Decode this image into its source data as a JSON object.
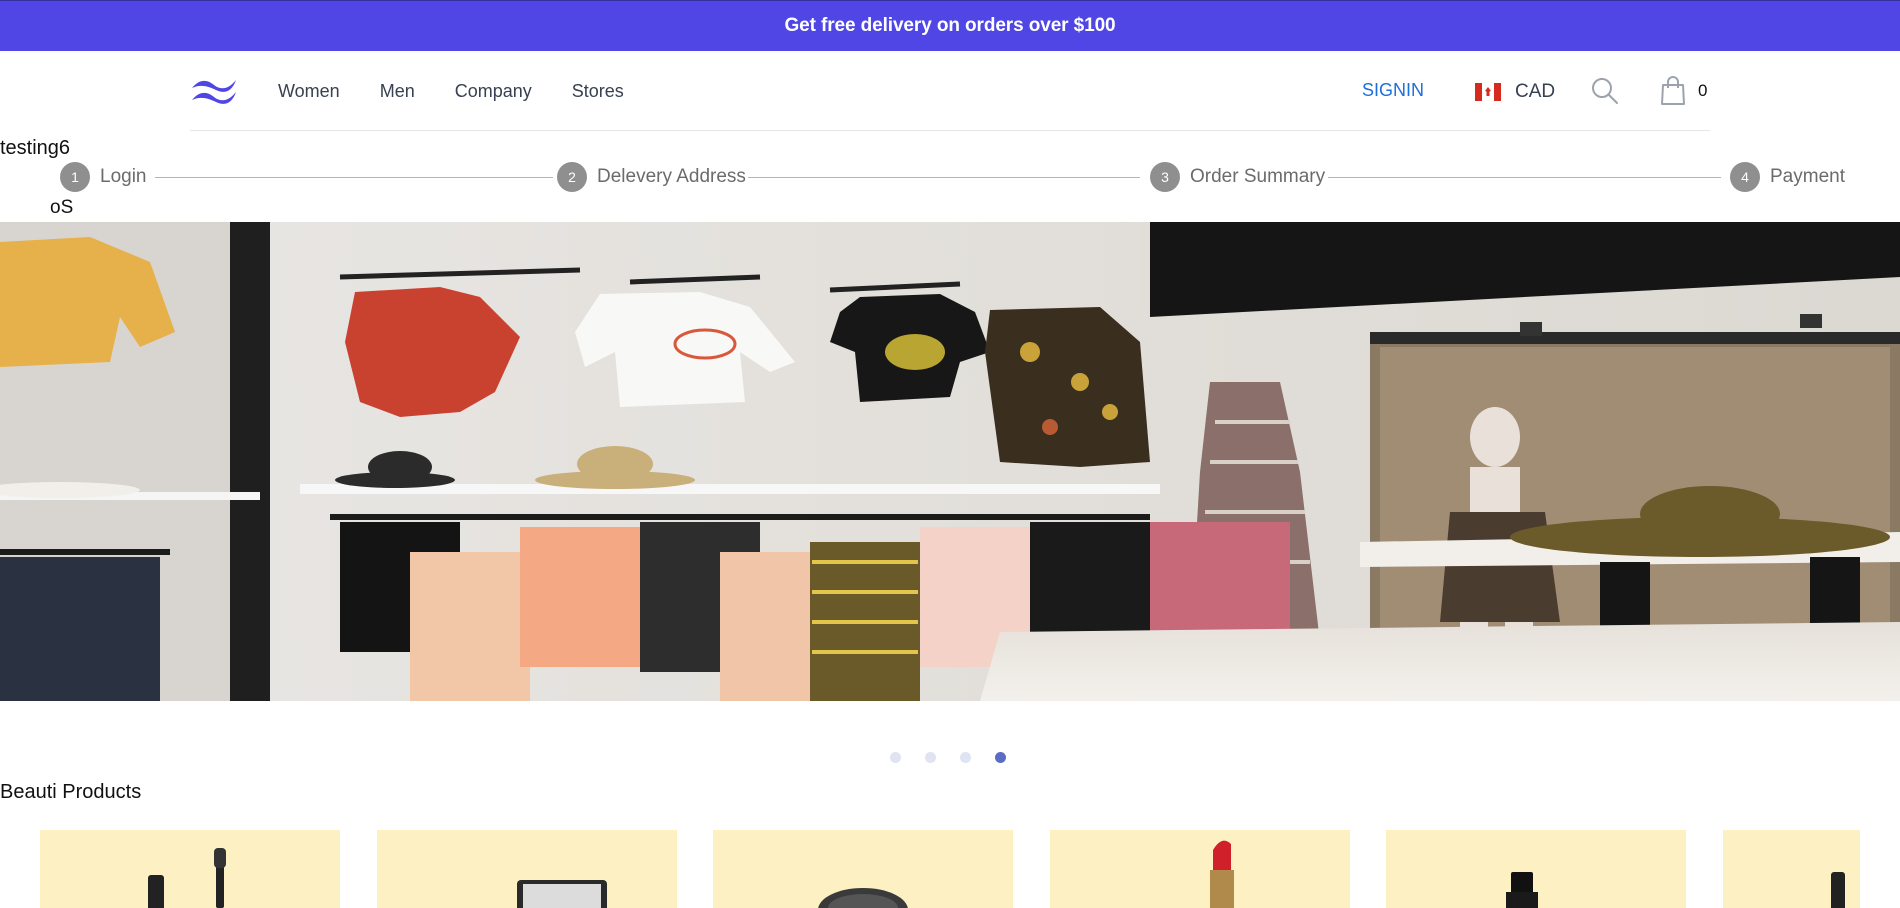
{
  "promo": {
    "text": "Get free delivery on orders over $100",
    "color": "#4f46e5"
  },
  "nav": {
    "items": [
      "Women",
      "Men",
      "Company",
      "Stores"
    ]
  },
  "header": {
    "signin_label": "SIGNIN",
    "currency_label": "CAD",
    "cart_count": "0",
    "signin_color": "#1e6fd9",
    "logo_icon": "tailwind-waves-logo",
    "flag_icon": "canada-flag-icon",
    "search_icon": "search-icon",
    "cart_icon": "shopping-bag-icon"
  },
  "user": {
    "name": "testing6",
    "os": "oS"
  },
  "steps": [
    {
      "number": "1",
      "label": "Login"
    },
    {
      "number": "2",
      "label": "Delevery Address"
    },
    {
      "number": "3",
      "label": "Order Summary"
    },
    {
      "number": "4",
      "label": "Payment"
    }
  ],
  "carousel": {
    "slide_count": 4,
    "active_index": 3
  },
  "products_section": {
    "title": "Beauti Products",
    "card_bg": "#fdf1c4"
  },
  "products": [
    {
      "icon": "mascara-icon"
    },
    {
      "icon": "mirror-compact-icon"
    },
    {
      "icon": "powder-jar-icon"
    },
    {
      "icon": "lipstick-icon"
    },
    {
      "icon": "foundation-bottle-icon"
    },
    {
      "icon": "mascara-icon"
    }
  ]
}
